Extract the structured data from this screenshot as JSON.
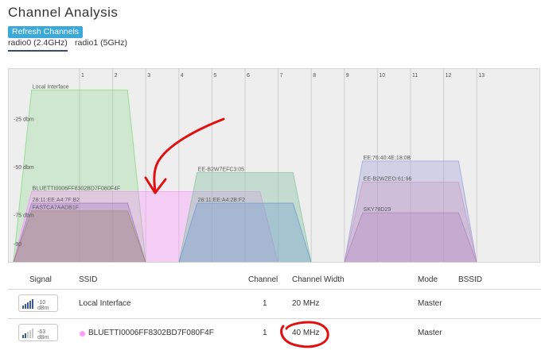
{
  "page": {
    "title": "Channel Analysis",
    "refresh_label": "Refresh Channels"
  },
  "tabs": [
    {
      "label": "radio0 (2.4GHz)",
      "active": true
    },
    {
      "label": "radio1 (5GHz)",
      "active": false
    }
  ],
  "chart_data": {
    "type": "area",
    "x_ticks": [
      "1",
      "2",
      "3",
      "4",
      "5",
      "6",
      "7",
      "8",
      "9",
      "10",
      "11",
      "12",
      "13"
    ],
    "y_ticks": [
      {
        "label": "-25 dbm",
        "value": -25
      },
      {
        "label": "-50 dbm",
        "value": -50
      },
      {
        "label": "-75 dbm",
        "value": -75
      },
      {
        "label": "-90",
        "value": -90
      }
    ],
    "ylim": [
      -100,
      -9
    ],
    "series": [
      {
        "name": "Local Interface",
        "channel": 1,
        "width_mhz": 20,
        "signal": -10,
        "color": "#7ed67e",
        "opacity": 0.28
      },
      {
        "name": "BLUETTI0006FF8302BD7F080F4F",
        "channel": 1,
        "width_mhz": 40,
        "signal": -63,
        "color": "#ff8cff",
        "opacity": 0.33
      },
      {
        "name": "28:11:EE:A4:7F:B2",
        "channel": 1,
        "width_mhz": 20,
        "signal": -69,
        "color": "#a070c0",
        "opacity": 0.3
      },
      {
        "name": "FASTCA7AADB1F",
        "channel": 1,
        "width_mhz": 20,
        "signal": -73,
        "color": "#9a8a6a",
        "opacity": 0.35
      },
      {
        "name": "EE-B2W7EFC3:05",
        "channel": 6,
        "width_mhz": 20,
        "signal": -53,
        "color": "#80c0a0",
        "opacity": 0.38
      },
      {
        "name": "28:11:EE:A4:2B:F2",
        "channel": 6,
        "width_mhz": 20,
        "signal": -69,
        "color": "#6a98d0",
        "opacity": 0.35
      },
      {
        "name": "EE:76:40:4E:18:0B",
        "channel": 11,
        "width_mhz": 20,
        "signal": -47,
        "color": "#9a9ad8",
        "opacity": 0.35
      },
      {
        "name": "EE-B2WZEO:61:96",
        "channel": 11,
        "width_mhz": 20,
        "signal": -58,
        "color": "#c898c0",
        "opacity": 0.33
      },
      {
        "name": "SKY78D29",
        "channel": 11,
        "width_mhz": 20,
        "signal": -74,
        "color": "#b080b8",
        "opacity": 0.3
      }
    ]
  },
  "table": {
    "headers": {
      "signal": "Signal",
      "ssid": "SSID",
      "channel": "Channel",
      "width": "Channel Width",
      "mode": "Mode",
      "bssid": "BSSID"
    },
    "rows": [
      {
        "signal": "-10 dBm",
        "ssid": "Local Interface",
        "channel": "1",
        "width": "20 MHz",
        "mode": "Master",
        "color": "",
        "bars": 5
      },
      {
        "signal": "-63 dBm",
        "ssid": "BLUETTI0006FF8302BD7F080F4F",
        "channel": "1",
        "width": "40 MHz",
        "mode": "Master",
        "color": "#ff9cff",
        "bars": 2
      }
    ]
  },
  "colors": {
    "accent": "#3aa8d8",
    "annotation": "#e01010"
  }
}
